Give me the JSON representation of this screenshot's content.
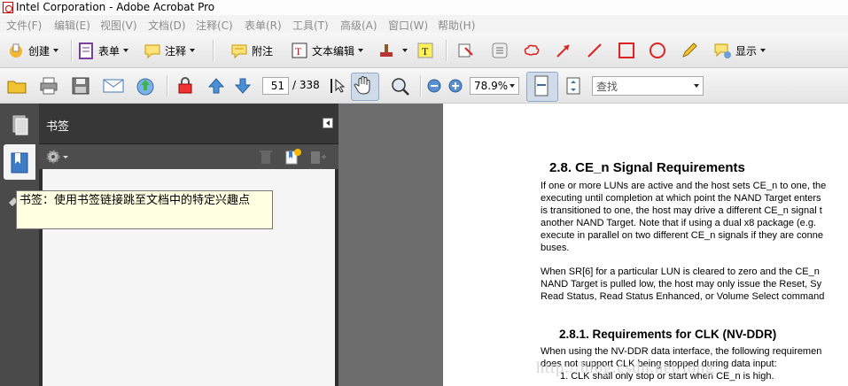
{
  "window": {
    "title": "Intel Corporation - Adobe Acrobat Pro"
  },
  "menubar": {
    "items": [
      {
        "label": "文件(F)"
      },
      {
        "label": "编辑(E)"
      },
      {
        "label": "视图(V)"
      },
      {
        "label": "文档(D)"
      },
      {
        "label": "注释(C)"
      },
      {
        "label": "表单(R)"
      },
      {
        "label": "工具(T)"
      },
      {
        "label": "高级(A)"
      },
      {
        "label": "窗口(W)"
      },
      {
        "label": "帮助(H)"
      }
    ]
  },
  "toolbar1": {
    "create": "创建",
    "forms": "表单",
    "comment": "注释",
    "attach": "附注",
    "text_edit": "文本编辑",
    "show": "显示"
  },
  "toolbar2": {
    "page_current": "51",
    "page_total": "/ 338",
    "zoom": "78.9%",
    "find_placeholder": "查找"
  },
  "bookmarks": {
    "title": "书签",
    "tooltip": "书签：使用书签链接跳至文档中的特定兴趣点"
  },
  "document": {
    "heading": "2.8.  CE_n Signal Requirements",
    "para1": [
      "If one or more LUNs are active and the host sets CE_n to one, the",
      "executing until completion at which point the NAND Target enters",
      "is transitioned to one, the host may drive a different CE_n signal t",
      "another NAND Target.  Note that if using a dual x8 package (e.g.",
      "execute in parallel on two different CE_n signals if they are conne",
      "buses."
    ],
    "para2": [
      "When SR[6] for a particular LUN is cleared to zero and the CE_n",
      "NAND Target is pulled low, the host may only issue the Reset, Sy",
      "Read Status, Read Status Enhanced, or Volume Select command"
    ],
    "subheading": "2.8.1.  Requirements for CLK (NV-DDR)",
    "para3": [
      "When using the NV-DDR data interface, the following requiremen",
      "does not support CLK being stopped during data input:"
    ],
    "list_item": "1.    CLK shall only stop or start when CE_n is high."
  },
  "watermark": "http://blog.csdn.net/long"
}
